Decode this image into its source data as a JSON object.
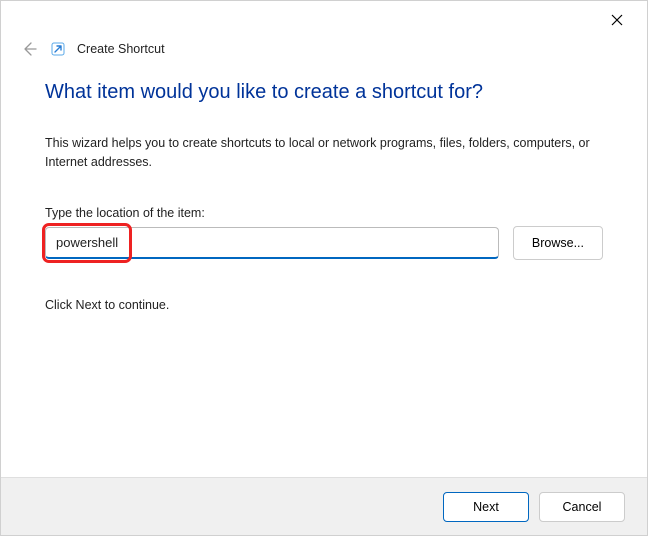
{
  "titlebar": {
    "close_icon": "close"
  },
  "header": {
    "back_icon": "back-arrow",
    "shortcut_icon": "shortcut",
    "title": "Create Shortcut"
  },
  "content": {
    "heading": "What item would you like to create a shortcut for?",
    "description": "This wizard helps you to create shortcuts to local or network programs, files, folders, computers, or Internet addresses.",
    "input_label": "Type the location of the item:",
    "input_value": "powershell",
    "browse_label": "Browse...",
    "continue_text": "Click Next to continue."
  },
  "footer": {
    "next_label": "Next",
    "cancel_label": "Cancel"
  },
  "annotation": {
    "highlight_target": "location-input"
  }
}
